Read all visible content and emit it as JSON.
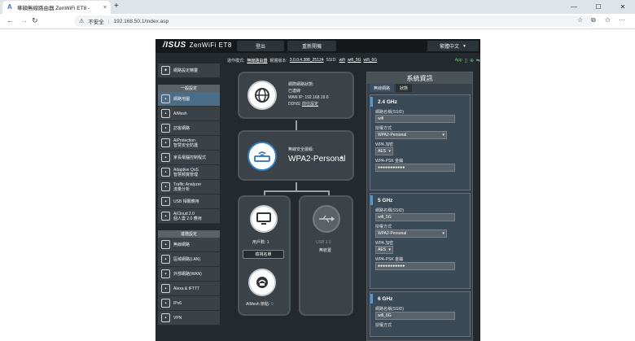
{
  "browser": {
    "tab_title": "華碩無線路由器 ZenWiFi ET8 -",
    "tab_close": "×",
    "newtab": "+",
    "insecure_label": "不安全",
    "url": "192.168.50.1/index.asp"
  },
  "router": {
    "brand": "/ISUS",
    "model": "ZenWiFi ET8",
    "logout_label": "登出",
    "reboot_label": "重新開機",
    "language": "繁體中文",
    "status": {
      "mode_label": "運作模式:",
      "mode_value": "無線路由器",
      "firmware_label": "韌體版本:",
      "firmware_value": "3.0.0.4.388_25124",
      "ssid_label": "SSID:",
      "ssid_1": "wifi",
      "ssid_2": "wifi_5G",
      "ssid_3": "wifi_6G",
      "app_label": "App"
    }
  },
  "sidebar": {
    "top_item": "網路設定精靈",
    "general_header": "一般設定",
    "general_items": [
      {
        "label": "網路地圖",
        "icon": "map-icon"
      },
      {
        "label": "AiMesh",
        "icon": "aimesh-icon"
      },
      {
        "label": "訪客網路",
        "icon": "guest-icon"
      },
      {
        "label": "AiProtection",
        "label2": "智慧安全防護",
        "icon": "shield-icon"
      },
      {
        "label": "家長電腦控制程式",
        "icon": "parental-icon"
      },
      {
        "label": "Adaptive QoS",
        "label2": "智慧頻寬管理",
        "icon": "qos-icon"
      },
      {
        "label": "Traffic Analyzer",
        "label2": "流量分析",
        "icon": "traffic-icon"
      },
      {
        "label": "USB 相關應用",
        "icon": "usb-icon"
      },
      {
        "label": "AiCloud 2.0",
        "label2": "個人雲 2.0 應用",
        "icon": "cloud-icon"
      }
    ],
    "advanced_header": "進階設定",
    "advanced_items": [
      {
        "label": "無線網路",
        "icon": "wireless-icon"
      },
      {
        "label": "區域網路(LAN)",
        "icon": "lan-icon"
      },
      {
        "label": "外部網路(WAN)",
        "icon": "wan-icon"
      },
      {
        "label": "Alexa & IFTTT",
        "icon": "alexa-icon"
      },
      {
        "label": "IPv6",
        "icon": "ipv6-icon"
      },
      {
        "label": "VPN",
        "icon": "vpn-icon"
      }
    ]
  },
  "map": {
    "internet_status_label": "網際網路狀態:",
    "internet_status_value": "已連線",
    "wan_ip_label": "WAN IP:",
    "wan_ip_value": "192.168.19.6",
    "ddns_label": "DDNS:",
    "ddns_value": "前往設定",
    "security_label": "無線安全層級:",
    "security_value": "WPA2-Personal",
    "clients_label": "用戶數:",
    "clients_value": "1",
    "clients_button": "檢視名單",
    "aimesh_label": "AiMesh 節點:",
    "aimesh_value": "0",
    "usb_label": "USB 3.0",
    "usb_status": "無裝置"
  },
  "panel": {
    "title": "系統資訊",
    "tab_wireless": "無線網路",
    "tab_status": "狀態",
    "ssid_label": "網路名稱(SSID)",
    "auth_label": "授權方式",
    "wpa_label": "WPA 加密",
    "psk_label": "WPA-PSK 金鑰",
    "bands": [
      {
        "name": "2.4 GHz",
        "ssid": "wifi",
        "auth": "WPA2-Personal",
        "wpa": "AES",
        "psk": "●●●●●●●●●●●"
      },
      {
        "name": "5 GHz",
        "ssid": "wifi_5G",
        "auth": "WPA2-Personal",
        "wpa": "AES",
        "psk": "●●●●●●●●●●●"
      },
      {
        "name": "6 GHz",
        "ssid": "wifi_6G",
        "auth": "",
        "wpa": "",
        "psk": ""
      }
    ]
  }
}
